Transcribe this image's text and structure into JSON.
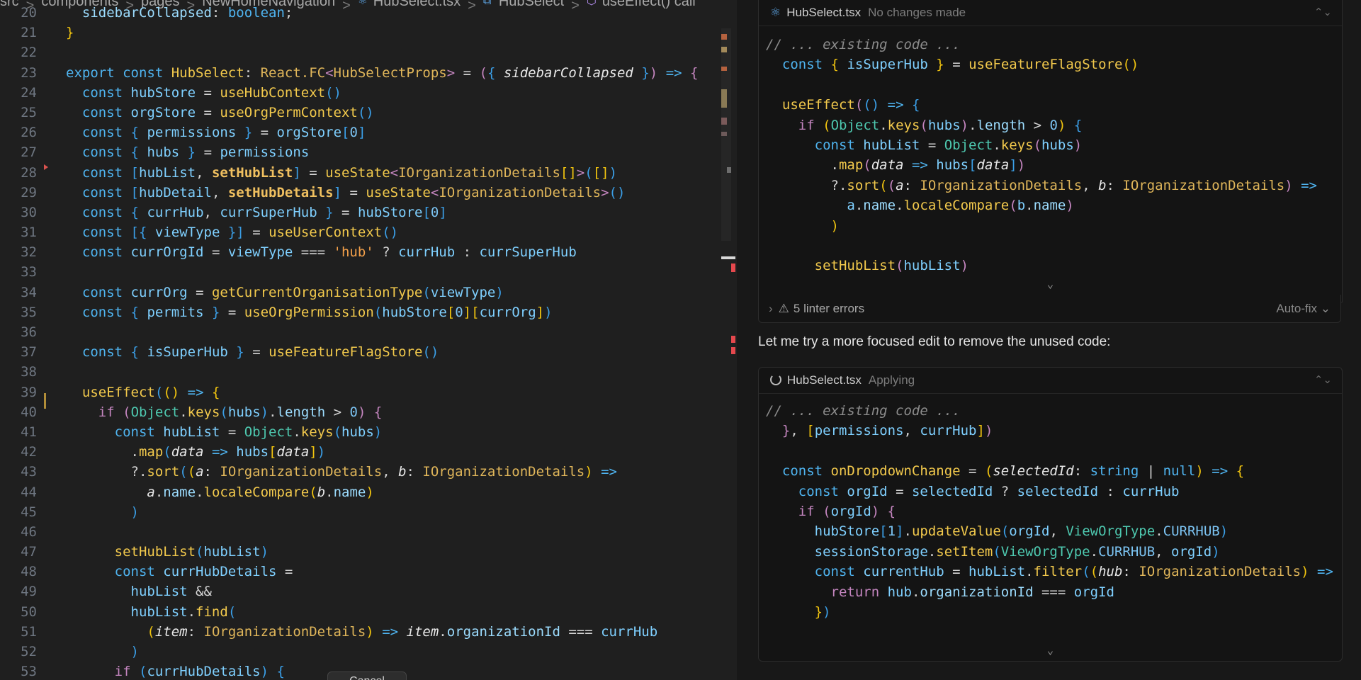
{
  "breadcrumb": [
    "src",
    "components",
    "pages",
    "NewHomeNavigation",
    "HubSelect.tsx",
    "HubSelect",
    "useEffect() call"
  ],
  "editor": {
    "lines": [
      {
        "n": "20",
        "html": "  <span class='prop'>sidebarCollapsed</span>: <span class='kw'>boolean</span>;"
      },
      {
        "n": "21",
        "html": "<span class='br1'>}</span>"
      },
      {
        "n": "22",
        "html": ""
      },
      {
        "n": "23",
        "html": "<span class='kw'>export const</span> <span class='fn'>HubSelect</span>: <span class='ty'>React.FC</span><span class='k2'>&lt;</span><span class='ty'>HubSelectProps</span><span class='k2'>&gt;</span> = <span class='br2'>(</span><span class='br3'>{</span> <span class='it'>sidebarCollapsed</span> <span class='br3'>}</span><span class='br2'>)</span> <span class='kw'>=&gt;</span> <span class='br2'>{</span>"
      },
      {
        "n": "24",
        "html": "  <span class='kw'>const</span> <span class='pa'>hubStore</span> = <span class='fn'>useHubContext</span><span class='br3'>()</span>"
      },
      {
        "n": "25",
        "html": "  <span class='kw'>const</span> <span class='pa'>orgStore</span> = <span class='fn'>useOrgPermContext</span><span class='br3'>()</span>"
      },
      {
        "n": "26",
        "html": "  <span class='kw'>const</span> <span class='br3'>{</span> <span class='pa'>permissions</span> <span class='br3'>}</span> = <span class='pa'>orgStore</span><span class='br3'>[</span><span class='nm'>0</span><span class='br3'>]</span>"
      },
      {
        "n": "27",
        "html": "  <span class='kw'>const</span> <span class='br3'>{</span> <span class='pa'>hubs</span> <span class='br3'>}</span> = <span class='pa'>permissions</span>"
      },
      {
        "n": "28",
        "html": "  <span class='kw'>const</span> <span class='br3'>[</span><span class='pa'>hubList</span>, <span class='bold'>setHubList</span><span class='br3'>]</span> = <span class='fn'>useState</span><span class='k2'>&lt;</span><span class='ty'>IOrganizationDetails</span><span class='br1'>[]</span><span class='k2'>&gt;</span><span class='br3'>(</span><span class='br1'>[]</span><span class='br3'>)</span>"
      },
      {
        "n": "29",
        "html": "  <span class='kw'>const</span> <span class='br3'>[</span><span class='pa'>hubDetail</span>, <span class='bold'>setHubDetails</span><span class='br3'>]</span> = <span class='fn'>useState</span><span class='k2'>&lt;</span><span class='ty'>IOrganizationDetails</span><span class='k2'>&gt;</span><span class='br3'>()</span>"
      },
      {
        "n": "30",
        "html": "  <span class='kw'>const</span> <span class='br3'>{</span> <span class='pa'>currHub</span>, <span class='pa'>currSuperHub</span> <span class='br3'>}</span> = <span class='pa'>hubStore</span><span class='br3'>[</span><span class='nm'>0</span><span class='br3'>]</span>"
      },
      {
        "n": "31",
        "html": "  <span class='kw'>const</span> <span class='br3'>[{</span> <span class='pa'>viewType</span> <span class='br3'>}]</span> = <span class='fn'>useUserContext</span><span class='br3'>()</span>"
      },
      {
        "n": "32",
        "html": "  <span class='kw'>const</span> <span class='pa'>currOrgId</span> = <span class='pa'>viewType</span> === <span class='st'>'hub'</span> ? <span class='pa'>currHub</span> : <span class='pa'>currSuperHub</span>"
      },
      {
        "n": "33",
        "html": ""
      },
      {
        "n": "34",
        "html": "  <span class='kw'>const</span> <span class='pa'>currOrg</span> = <span class='fn'>getCurrentOrganisationType</span><span class='br3'>(</span><span class='pa'>viewType</span><span class='br3'>)</span>"
      },
      {
        "n": "35",
        "html": "  <span class='kw'>const</span> <span class='br3'>{</span> <span class='pa'>permits</span> <span class='br3'>}</span> = <span class='fn'>useOrgPermission</span><span class='br3'>(</span><span class='pa'>hubStore</span><span class='br1'>[</span><span class='nm'>0</span><span class='br1'>][</span><span class='pa'>currOrg</span><span class='br1'>]</span><span class='br3'>)</span>"
      },
      {
        "n": "36",
        "html": ""
      },
      {
        "n": "37",
        "html": "  <span class='kw'>const</span> <span class='br3'>{</span> <span class='pa'>isSuperHub</span> <span class='br3'>}</span> = <span class='fn'>useFeatureFlagStore</span><span class='br3'>()</span>"
      },
      {
        "n": "38",
        "html": ""
      },
      {
        "n": "39",
        "html": "  <span class='fn'>useEffect</span><span class='br3'>(</span><span class='br1'>()</span> <span class='kw'>=&gt;</span> <span class='br1'>{</span>"
      },
      {
        "n": "40",
        "html": "    <span class='k2'>if</span> <span class='br2'>(</span><span class='const'>Object</span>.<span class='fn'>keys</span><span class='br3'>(</span><span class='pa'>hubs</span><span class='br3'>)</span>.<span class='prop'>length</span> &gt; <span class='nm'>0</span><span class='br2'>)</span> <span class='br2'>{</span>"
      },
      {
        "n": "41",
        "html": "      <span class='kw'>const</span> <span class='pa'>hubList</span> = <span class='const'>Object</span>.<span class='fn'>keys</span><span class='br3'>(</span><span class='pa'>hubs</span><span class='br3'>)</span>"
      },
      {
        "n": "42",
        "html": "        .<span class='fn'>map</span><span class='br3'>(</span><span class='it'>data</span> <span class='kw'>=&gt;</span> <span class='pa'>hubs</span><span class='br1'>[</span><span class='it'>data</span><span class='br1'>]</span><span class='br3'>)</span>"
      },
      {
        "n": "43",
        "html": "        ?.<span class='fn'>sort</span><span class='br3'>(</span><span class='br1'>(</span><span class='it'>a</span>: <span class='ty'>IOrganizationDetails</span>, <span class='it'>b</span>: <span class='ty'>IOrganizationDetails</span><span class='br1'>)</span> <span class='kw'>=&gt;</span>"
      },
      {
        "n": "44",
        "html": "          <span class='it'>a</span>.<span class='prop'>name</span>.<span class='fn'>localeCompare</span><span class='br1'>(</span><span class='it'>b</span>.<span class='prop'>name</span><span class='br1'>)</span>"
      },
      {
        "n": "45",
        "html": "        <span class='br3'>)</span>"
      },
      {
        "n": "46",
        "html": ""
      },
      {
        "n": "47",
        "html": "      <span class='fn'>setHubList</span><span class='br3'>(</span><span class='pa'>hubList</span><span class='br3'>)</span>"
      },
      {
        "n": "48",
        "html": "      <span class='kw'>const</span> <span class='pa'>currHubDetails</span> ="
      },
      {
        "n": "49",
        "html": "        <span class='pa'>hubList</span> &amp;&amp;"
      },
      {
        "n": "50",
        "html": "        <span class='pa'>hubList</span>.<span class='fn'>find</span><span class='br3'>(</span>"
      },
      {
        "n": "51",
        "html": "          <span class='br1'>(</span><span class='it'>item</span>: <span class='ty'>IOrganizationDetails</span><span class='br1'>)</span> <span class='kw'>=&gt;</span> <span class='it'>item</span>.<span class='prop'>organizationId</span> === <span class='pa'>currHub</span>"
      },
      {
        "n": "52",
        "html": "        <span class='br3'>)</span>"
      },
      {
        "n": "53",
        "html": "      <span class='k2'>if</span> <span class='br3'>(</span><span class='pa'>currHubDetails</span><span class='br3'>)</span> <span class='br3'>{</span>"
      }
    ],
    "cancel_label": "Cancel"
  },
  "chat": {
    "card1": {
      "filename": "HubSelect.tsx",
      "status": "No changes made",
      "lines": [
        "<span class='cm'>// ... existing code ...</span>",
        "  <span class='kw'>const</span> <span class='br1'>{</span> <span class='pa'>isSuperHub</span> <span class='br1'>}</span> = <span class='fn'>useFeatureFlagStore</span><span class='br1'>()</span>",
        "",
        "  <span class='fn'>useEffect</span><span class='br2'>(</span><span class='br3'>()</span> <span class='kw'>=&gt;</span> <span class='br3'>{</span>",
        "    <span class='k2'>if</span> <span class='br1'>(</span><span class='const'>Object</span>.<span class='fn'>keys</span><span class='br2'>(</span><span class='pa'>hubs</span><span class='br2'>)</span>.<span class='prop'>length</span> &gt; <span class='nm'>0</span><span class='br1'>)</span> <span class='br3'>{</span>",
        "      <span class='kw'>const</span> <span class='pa'>hubList</span> = <span class='const'>Object</span>.<span class='fn'>keys</span><span class='br2'>(</span><span class='pa'>hubs</span><span class='br2'>)</span>",
        "        .<span class='fn'>map</span><span class='br2'>(</span><span class='it'>data</span> <span class='kw'>=&gt;</span> <span class='pa'>hubs</span><span class='br3'>[</span><span class='it'>data</span><span class='br3'>]</span><span class='br2'>)</span>",
        "        ?.<span class='fn'>sort</span><span class='br1'>(</span><span class='br2'>(</span><span class='it'>a</span>: <span class='ty'>IOrganizationDetails</span>, <span class='it'>b</span>: <span class='ty'>IOrganizationDetails</span><span class='br2'>)</span> <span class='kw'>=&gt;</span>",
        "          <span class='pa'>a</span>.<span class='prop'>name</span>.<span class='fn'>localeCompare</span><span class='br2'>(</span><span class='pa'>b</span>.<span class='prop'>name</span><span class='br2'>)</span>",
        "        <span class='br1'>)</span>",
        "",
        "      <span class='fn'>setHubList</span><span class='br2'>(</span><span class='pa'>hubList</span><span class='br2'>)</span>"
      ]
    },
    "lint": {
      "label": "5 linter errors",
      "autofix": "Auto-fix"
    },
    "message": "Let me try a more focused edit to remove the unused code:",
    "card2": {
      "filename": "HubSelect.tsx",
      "status": "Applying",
      "lines": [
        "<span class='cm'>// ... existing code ...</span>",
        "  <span class='br2'>}</span>, <span class='br1'>[</span><span class='pa'>permissions</span>, <span class='pa'>currHub</span><span class='br1'>]</span><span class='br2'>)</span>",
        "",
        "  <span class='kw'>const</span> <span class='fn'>onDropdownChange</span> = <span class='br1'>(</span><span class='it'>selectedId</span>: <span class='kw'>string</span> | <span class='kw'>null</span><span class='br1'>)</span> <span class='kw'>=&gt;</span> <span class='br1'>{</span>",
        "    <span class='kw'>const</span> <span class='pa'>orgId</span> = <span class='pa'>selectedId</span> ? <span class='pa'>selectedId</span> : <span class='pa'>currHub</span>",
        "    <span class='k2'>if</span> <span class='br2'>(</span><span class='pa'>orgId</span><span class='br2'>)</span> <span class='br2'>{</span>",
        "      <span class='pa'>hubStore</span><span class='br3'>[</span><span class='nm'>1</span><span class='br3'>]</span>.<span class='fn'>updateValue</span><span class='br3'>(</span><span class='pa'>orgId</span>, <span class='const'>ViewOrgType</span>.<span class='nm'>CURRHUB</span><span class='br3'>)</span>",
        "      <span class='pa'>sessionStorage</span>.<span class='fn'>setItem</span><span class='br3'>(</span><span class='const'>ViewOrgType</span>.<span class='nm'>CURRHUB</span>, <span class='pa'>orgId</span><span class='br3'>)</span>",
        "      <span class='kw'>const</span> <span class='pa'>currentHub</span> = <span class='pa'>hubList</span>.<span class='fn'>filter</span><span class='br3'>(</span><span class='br1'>(</span><span class='it'>hub</span>: <span class='ty'>IOrganizationDetails</span><span class='br1'>)</span> <span class='kw'>=&gt;</span>",
        "        <span class='k2'>return</span> <span class='pa'>hub</span>.<span class='prop'>organizationId</span> === <span class='pa'>orgId</span>",
        "      <span class='br1'>}</span><span class='br3'>)</span>"
      ]
    }
  },
  "colors": {
    "accent": "#4fb4f0",
    "warning": "#b18d38",
    "error": "#e5484d"
  }
}
